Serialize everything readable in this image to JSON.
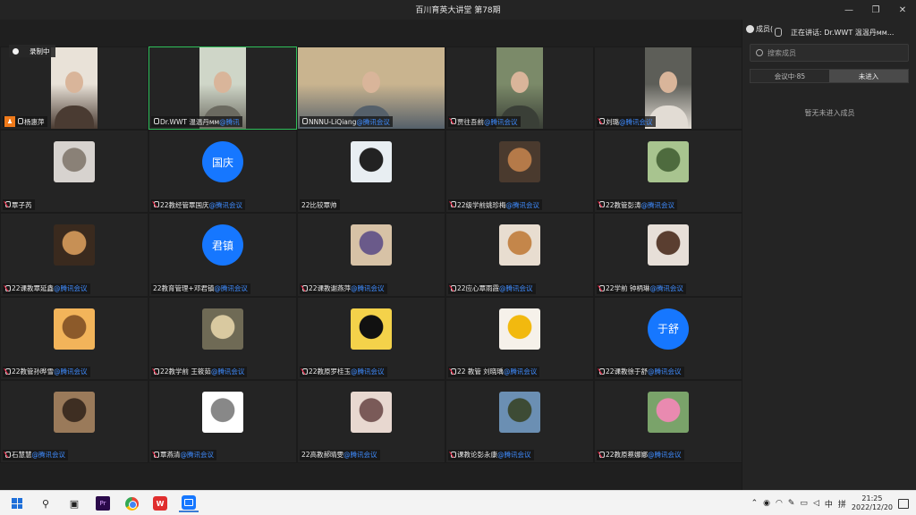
{
  "window": {
    "title": "百川育英大讲堂 第78期"
  },
  "recording": {
    "label": "录制中"
  },
  "speaking": {
    "label": "正在讲话: Dr.WWT 温温丹мм..."
  },
  "panel": {
    "header": "成员(",
    "search_placeholder": "搜索成员",
    "tabs": [
      "会议中·85",
      "未进入"
    ],
    "empty_text": "暂无未进入成员"
  },
  "colors": {
    "accent": "#1677ff",
    "active_border": "#2fbf5a",
    "suffix": "#3f8cff",
    "host_badge": "#f07a1a"
  },
  "suffix": "@腾讯会议",
  "tiles": [
    {
      "name": "杨惠萍",
      "suffix": "",
      "kind": "video",
      "mic": "on",
      "host": true
    },
    {
      "name": "Dr.WWT 温温丹мм",
      "suffix": "@腾讯",
      "kind": "video",
      "mic": "on",
      "active": true
    },
    {
      "name": "NNNU-LiQiang",
      "suffix": "@腾讯会议",
      "kind": "video-wide",
      "mic": "on"
    },
    {
      "name": "贾往吾前",
      "suffix": "@腾讯会议",
      "kind": "video",
      "mic": "off"
    },
    {
      "name": "刘璐",
      "suffix": "@腾讯会议",
      "kind": "video",
      "mic": "off"
    },
    {
      "name": "覃子芮",
      "suffix": "",
      "kind": "photo",
      "mic": "off"
    },
    {
      "name": "22教经管覃国庆",
      "suffix": "@腾讯会议",
      "kind": "circle",
      "initials": "国庆",
      "mic": "off"
    },
    {
      "name": "22比较覃帅",
      "suffix": "",
      "kind": "photo",
      "mic": "none"
    },
    {
      "name": "22级学前姚珍梅",
      "suffix": "@腾讯会议",
      "kind": "photo",
      "mic": "off"
    },
    {
      "name": "22教管彭涛",
      "suffix": "@腾讯会议",
      "kind": "photo",
      "mic": "off"
    },
    {
      "name": "22课教覃延鑫",
      "suffix": "@腾讯会议",
      "kind": "photo",
      "mic": "off"
    },
    {
      "name": "22教育管理+邓君镇",
      "suffix": "@腾讯会议",
      "kind": "circle",
      "initials": "君镇",
      "mic": "none"
    },
    {
      "name": "22课教谢燕萍",
      "suffix": "@腾讯会议",
      "kind": "photo",
      "mic": "off"
    },
    {
      "name": "22应心覃雨霞",
      "suffix": "@腾讯会议",
      "kind": "photo",
      "mic": "off"
    },
    {
      "name": "22学前 钟柄琳",
      "suffix": "@腾讯会议",
      "kind": "photo",
      "mic": "off"
    },
    {
      "name": "22教管孙晔雪",
      "suffix": "@腾讯会议",
      "kind": "photo",
      "mic": "off"
    },
    {
      "name": "22教学前 王筱茹",
      "suffix": "@腾讯会议",
      "kind": "photo",
      "mic": "off"
    },
    {
      "name": "22教原罗桂玉",
      "suffix": "@腾讯会议",
      "kind": "photo",
      "mic": "off"
    },
    {
      "name": "22 教管 刘晓瑀",
      "suffix": "@腾讯会议",
      "kind": "photo",
      "mic": "off"
    },
    {
      "name": "22课教徐于舒",
      "suffix": "@腾讯会议",
      "kind": "circle",
      "initials": "于舒",
      "mic": "off"
    },
    {
      "name": "石慧慧",
      "suffix": "@腾讯会议",
      "kind": "photo",
      "mic": "off"
    },
    {
      "name": "覃燕清",
      "suffix": "@腾讯会议",
      "kind": "photo",
      "mic": "off"
    },
    {
      "name": "22高教郝晴雯",
      "suffix": "@腾讯会议",
      "kind": "photo",
      "mic": "none"
    },
    {
      "name": "课教论彭永康",
      "suffix": "@腾讯会议",
      "kind": "photo",
      "mic": "off"
    },
    {
      "name": "22教原蔡娜娜",
      "suffix": "@腾讯会议",
      "kind": "photo",
      "mic": "off"
    }
  ],
  "taskbar": {
    "time": "21:25",
    "date": "2022/12/20",
    "ime": "中",
    "ime2": "拼"
  }
}
